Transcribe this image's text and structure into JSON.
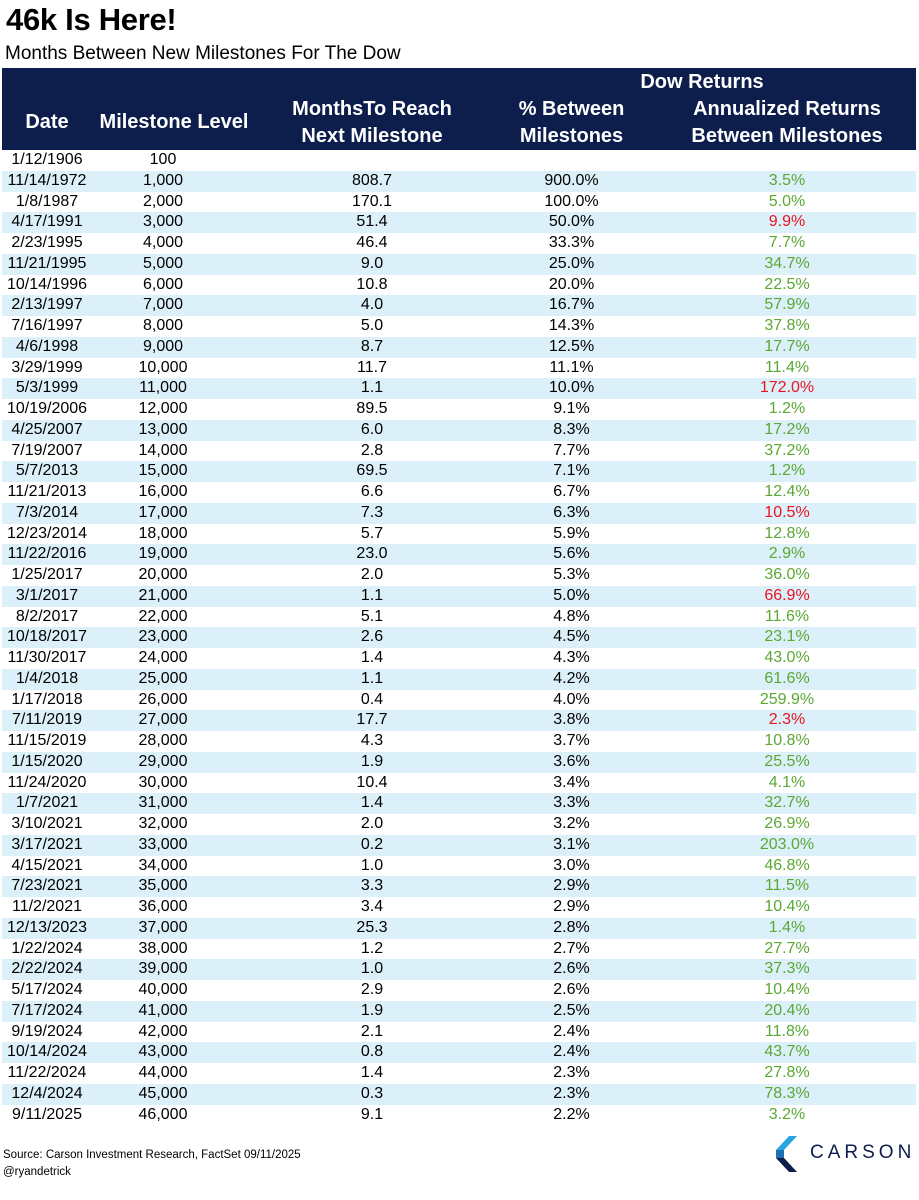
{
  "title": "46k Is Here!",
  "subtitle": "Months Between New Milestones For The Dow",
  "colors": {
    "header_bg": "#0d1d4c",
    "alt_row": "#dcf0fa",
    "positive": "#5aa832",
    "negative": "#e8141e",
    "logo_blue": "#0d1d4c"
  },
  "headers": {
    "date": "Date",
    "level": "Milestone Level",
    "months": "MonthsTo Reach\nNext Milestone",
    "group": "Dow Returns",
    "pct": "% Between\nMilestones",
    "ann": "Annualized Returns\nBetween Milestones"
  },
  "footer": {
    "source": "Source: Carson Investment Research, FactSet 09/11/2025",
    "handle": "@ryandetrick"
  },
  "logo": {
    "text": "CARSON",
    "icon": "carson-logo-icon"
  },
  "chart_data": {
    "type": "table",
    "columns": [
      "Date",
      "Milestone Level",
      "MonthsTo Reach Next Milestone",
      "% Between Milestones",
      "Annualized Returns Between Milestones"
    ],
    "rows": [
      {
        "date": "1/12/1906",
        "level": "100",
        "months": "",
        "pct": "",
        "ann": "",
        "ann_color": ""
      },
      {
        "date": "11/14/1972",
        "level": "1,000",
        "months": "808.7",
        "pct": "900.0%",
        "ann": "3.5%",
        "ann_color": "positive"
      },
      {
        "date": "1/8/1987",
        "level": "2,000",
        "months": "170.1",
        "pct": "100.0%",
        "ann": "5.0%",
        "ann_color": "positive"
      },
      {
        "date": "4/17/1991",
        "level": "3,000",
        "months": "51.4",
        "pct": "50.0%",
        "ann": "9.9%",
        "ann_color": "negative"
      },
      {
        "date": "2/23/1995",
        "level": "4,000",
        "months": "46.4",
        "pct": "33.3%",
        "ann": "7.7%",
        "ann_color": "positive"
      },
      {
        "date": "11/21/1995",
        "level": "5,000",
        "months": "9.0",
        "pct": "25.0%",
        "ann": "34.7%",
        "ann_color": "positive"
      },
      {
        "date": "10/14/1996",
        "level": "6,000",
        "months": "10.8",
        "pct": "20.0%",
        "ann": "22.5%",
        "ann_color": "positive"
      },
      {
        "date": "2/13/1997",
        "level": "7,000",
        "months": "4.0",
        "pct": "16.7%",
        "ann": "57.9%",
        "ann_color": "positive"
      },
      {
        "date": "7/16/1997",
        "level": "8,000",
        "months": "5.0",
        "pct": "14.3%",
        "ann": "37.8%",
        "ann_color": "positive"
      },
      {
        "date": "4/6/1998",
        "level": "9,000",
        "months": "8.7",
        "pct": "12.5%",
        "ann": "17.7%",
        "ann_color": "positive"
      },
      {
        "date": "3/29/1999",
        "level": "10,000",
        "months": "11.7",
        "pct": "11.1%",
        "ann": "11.4%",
        "ann_color": "positive"
      },
      {
        "date": "5/3/1999",
        "level": "11,000",
        "months": "1.1",
        "pct": "10.0%",
        "ann": "172.0%",
        "ann_color": "negative"
      },
      {
        "date": "10/19/2006",
        "level": "12,000",
        "months": "89.5",
        "pct": "9.1%",
        "ann": "1.2%",
        "ann_color": "positive"
      },
      {
        "date": "4/25/2007",
        "level": "13,000",
        "months": "6.0",
        "pct": "8.3%",
        "ann": "17.2%",
        "ann_color": "positive"
      },
      {
        "date": "7/19/2007",
        "level": "14,000",
        "months": "2.8",
        "pct": "7.7%",
        "ann": "37.2%",
        "ann_color": "positive"
      },
      {
        "date": "5/7/2013",
        "level": "15,000",
        "months": "69.5",
        "pct": "7.1%",
        "ann": "1.2%",
        "ann_color": "positive"
      },
      {
        "date": "11/21/2013",
        "level": "16,000",
        "months": "6.6",
        "pct": "6.7%",
        "ann": "12.4%",
        "ann_color": "positive"
      },
      {
        "date": "7/3/2014",
        "level": "17,000",
        "months": "7.3",
        "pct": "6.3%",
        "ann": "10.5%",
        "ann_color": "negative"
      },
      {
        "date": "12/23/2014",
        "level": "18,000",
        "months": "5.7",
        "pct": "5.9%",
        "ann": "12.8%",
        "ann_color": "positive"
      },
      {
        "date": "11/22/2016",
        "level": "19,000",
        "months": "23.0",
        "pct": "5.6%",
        "ann": "2.9%",
        "ann_color": "positive"
      },
      {
        "date": "1/25/2017",
        "level": "20,000",
        "months": "2.0",
        "pct": "5.3%",
        "ann": "36.0%",
        "ann_color": "positive"
      },
      {
        "date": "3/1/2017",
        "level": "21,000",
        "months": "1.1",
        "pct": "5.0%",
        "ann": "66.9%",
        "ann_color": "negative"
      },
      {
        "date": "8/2/2017",
        "level": "22,000",
        "months": "5.1",
        "pct": "4.8%",
        "ann": "11.6%",
        "ann_color": "positive"
      },
      {
        "date": "10/18/2017",
        "level": "23,000",
        "months": "2.6",
        "pct": "4.5%",
        "ann": "23.1%",
        "ann_color": "positive"
      },
      {
        "date": "11/30/2017",
        "level": "24,000",
        "months": "1.4",
        "pct": "4.3%",
        "ann": "43.0%",
        "ann_color": "positive"
      },
      {
        "date": "1/4/2018",
        "level": "25,000",
        "months": "1.1",
        "pct": "4.2%",
        "ann": "61.6%",
        "ann_color": "positive"
      },
      {
        "date": "1/17/2018",
        "level": "26,000",
        "months": "0.4",
        "pct": "4.0%",
        "ann": "259.9%",
        "ann_color": "positive"
      },
      {
        "date": "7/11/2019",
        "level": "27,000",
        "months": "17.7",
        "pct": "3.8%",
        "ann": "2.3%",
        "ann_color": "negative"
      },
      {
        "date": "11/15/2019",
        "level": "28,000",
        "months": "4.3",
        "pct": "3.7%",
        "ann": "10.8%",
        "ann_color": "positive"
      },
      {
        "date": "1/15/2020",
        "level": "29,000",
        "months": "1.9",
        "pct": "3.6%",
        "ann": "25.5%",
        "ann_color": "positive"
      },
      {
        "date": "11/24/2020",
        "level": "30,000",
        "months": "10.4",
        "pct": "3.4%",
        "ann": "4.1%",
        "ann_color": "positive"
      },
      {
        "date": "1/7/2021",
        "level": "31,000",
        "months": "1.4",
        "pct": "3.3%",
        "ann": "32.7%",
        "ann_color": "positive"
      },
      {
        "date": "3/10/2021",
        "level": "32,000",
        "months": "2.0",
        "pct": "3.2%",
        "ann": "26.9%",
        "ann_color": "positive"
      },
      {
        "date": "3/17/2021",
        "level": "33,000",
        "months": "0.2",
        "pct": "3.1%",
        "ann": "203.0%",
        "ann_color": "positive"
      },
      {
        "date": "4/15/2021",
        "level": "34,000",
        "months": "1.0",
        "pct": "3.0%",
        "ann": "46.8%",
        "ann_color": "positive"
      },
      {
        "date": "7/23/2021",
        "level": "35,000",
        "months": "3.3",
        "pct": "2.9%",
        "ann": "11.5%",
        "ann_color": "positive"
      },
      {
        "date": "11/2/2021",
        "level": "36,000",
        "months": "3.4",
        "pct": "2.9%",
        "ann": "10.4%",
        "ann_color": "positive"
      },
      {
        "date": "12/13/2023",
        "level": "37,000",
        "months": "25.3",
        "pct": "2.8%",
        "ann": "1.4%",
        "ann_color": "positive"
      },
      {
        "date": "1/22/2024",
        "level": "38,000",
        "months": "1.2",
        "pct": "2.7%",
        "ann": "27.7%",
        "ann_color": "positive"
      },
      {
        "date": "2/22/2024",
        "level": "39,000",
        "months": "1.0",
        "pct": "2.6%",
        "ann": "37.3%",
        "ann_color": "positive"
      },
      {
        "date": "5/17/2024",
        "level": "40,000",
        "months": "2.9",
        "pct": "2.6%",
        "ann": "10.4%",
        "ann_color": "positive"
      },
      {
        "date": "7/17/2024",
        "level": "41,000",
        "months": "1.9",
        "pct": "2.5%",
        "ann": "20.4%",
        "ann_color": "positive"
      },
      {
        "date": "9/19/2024",
        "level": "42,000",
        "months": "2.1",
        "pct": "2.4%",
        "ann": "11.8%",
        "ann_color": "positive"
      },
      {
        "date": "10/14/2024",
        "level": "43,000",
        "months": "0.8",
        "pct": "2.4%",
        "ann": "43.7%",
        "ann_color": "positive"
      },
      {
        "date": "11/22/2024",
        "level": "44,000",
        "months": "1.4",
        "pct": "2.3%",
        "ann": "27.8%",
        "ann_color": "positive"
      },
      {
        "date": "12/4/2024",
        "level": "45,000",
        "months": "0.3",
        "pct": "2.3%",
        "ann": "78.3%",
        "ann_color": "positive"
      },
      {
        "date": "9/11/2025",
        "level": "46,000",
        "months": "9.1",
        "pct": "2.2%",
        "ann": "3.2%",
        "ann_color": "positive"
      }
    ]
  }
}
